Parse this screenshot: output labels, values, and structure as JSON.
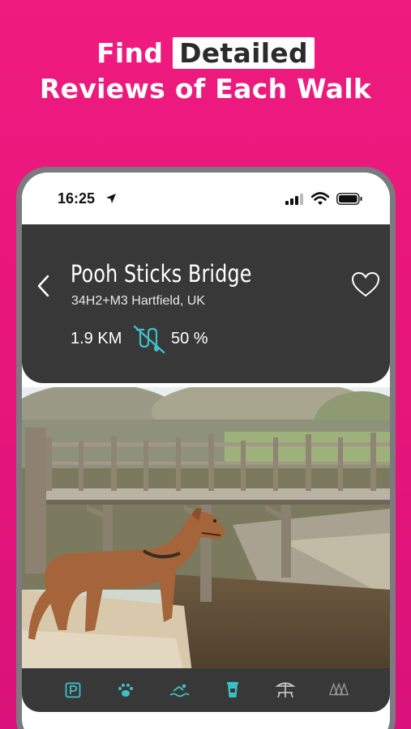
{
  "headline": {
    "prefix": "Find",
    "highlight": "Detailed",
    "line2": "Reviews of Each Walk"
  },
  "status_bar": {
    "time": "16:25"
  },
  "walk": {
    "title": "Pooh Sticks Bridge",
    "address": "34H2+M3 Hartfield, UK",
    "distance": "1.9 KM",
    "off_lead_percent": "50 %"
  },
  "icons": {
    "back": "chevron-left-icon",
    "favorite": "heart-icon",
    "off_lead": "no-lead-icon",
    "amenities": [
      "parking-icon",
      "paw-icon",
      "swimming-icon",
      "cafe-icon",
      "picnic-icon",
      "forest-icon"
    ]
  },
  "colors": {
    "background": "#e8167d",
    "header": "#383838",
    "accent": "#3cc0c8",
    "amenity_inactive": "#9a9a9a"
  }
}
